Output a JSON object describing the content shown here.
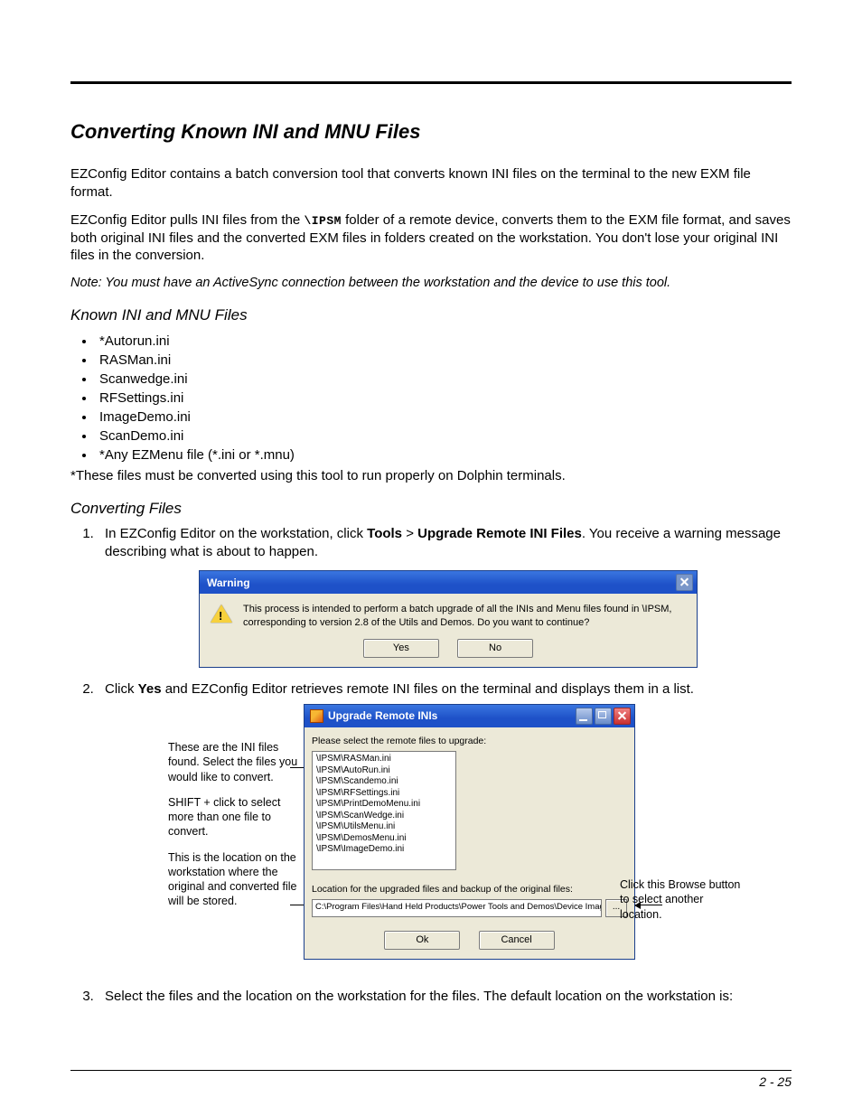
{
  "title": "Converting Known INI and MNU Files",
  "p1": "EZConfig Editor contains a batch conversion tool that converts known INI files on the terminal to the new EXM file format.",
  "p2a": "EZConfig Editor pulls INI files from the ",
  "p2_mono": "\\IPSM",
  "p2b": " folder of a remote device, converts them to the EXM file format, and saves both original INI files and the converted EXM files in folders created on the workstation. You don't lose your original INI files in the conversion.",
  "note": "Note: You must have an ActiveSync connection between the workstation and the device to use this tool.",
  "sub_known": "Known INI and MNU Files",
  "known_files": [
    "*Autorun.ini",
    "RASMan.ini",
    "Scanwedge.ini",
    "RFSettings.ini",
    "ImageDemo.ini",
    "ScanDemo.ini",
    "*Any EZMenu file (*.ini or *.mnu)"
  ],
  "after_list": "*These files must be converted using this tool to run properly on Dolphin terminals.",
  "sub_conv": "Converting Files",
  "step1_a": "In EZConfig Editor on the workstation, click ",
  "step1_b": "Tools",
  "step1_c": " > ",
  "step1_d": "Upgrade Remote INI Files",
  "step1_e": ". You receive a warning message describing what is about to happen.",
  "warning": {
    "title": "Warning",
    "msg": "This process is intended to perform a batch upgrade of all the INIs and Menu files found in \\IPSM, corresponding to version 2.8 of the Utils and Demos. Do you want to continue?",
    "yes": "Yes",
    "no": "No"
  },
  "step2_a": "Click ",
  "step2_b": "Yes",
  "step2_c": " and EZConfig Editor retrieves remote INI files on the terminal and displays them in a list.",
  "annot_left_1": "These are the INI files found. Select the files you would like to convert.",
  "annot_left_2": "SHIFT + click to select more than one file to convert.",
  "annot_left_3": "This is the location on the workstation where the original and converted file will be stored.",
  "annot_right": "Click this Browse button to select another location.",
  "upgrade": {
    "title": "Upgrade Remote INIs",
    "prompt": "Please select the remote files to upgrade:",
    "files": [
      "\\IPSM\\RASMan.ini",
      "\\IPSM\\AutoRun.ini",
      "\\IPSM\\Scandemo.ini",
      "\\IPSM\\RFSettings.ini",
      "\\IPSM\\PrintDemoMenu.ini",
      "\\IPSM\\ScanWedge.ini",
      "\\IPSM\\UtilsMenu.ini",
      "\\IPSM\\DemosMenu.ini",
      "\\IPSM\\ImageDemo.ini"
    ],
    "loc_label": "Location for the upgraded files and backup of the original files:",
    "loc_value": "C:\\Program Files\\Hand Held Products\\Power Tools and Demos\\Device Image\\C",
    "browse": "...",
    "ok": "Ok",
    "cancel": "Cancel"
  },
  "step3": "Select the files and the location on the workstation for the files. The default location on the workstation is:",
  "page_no": "2 - 25"
}
